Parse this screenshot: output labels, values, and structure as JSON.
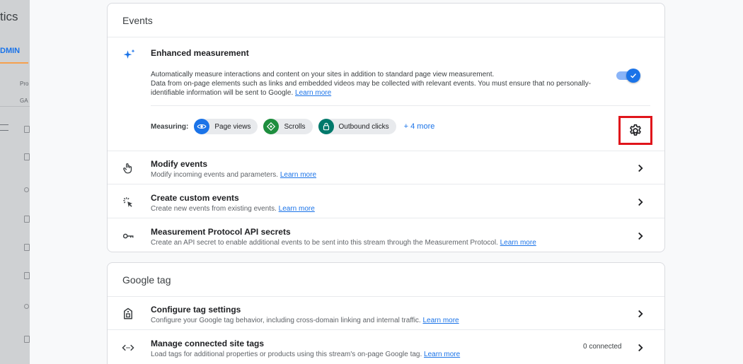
{
  "background": {
    "brand_partial": "tics",
    "admin_tab_partial": "DMIN",
    "property_partial": "Pro",
    "id_partial": "GA"
  },
  "events_card": {
    "title": "Events",
    "enhanced": {
      "title": "Enhanced measurement",
      "description_line1": "Automatically measure interactions and content on your sites in addition to standard page view measurement.",
      "description_line2": "Data from on-page elements such as links and embedded videos may be collected with relevant events. You must ensure that no personally-identifiable information will be sent to Google.",
      "learn_more": "Learn more",
      "toggle_on": true,
      "measuring_label": "Measuring:",
      "chips": [
        {
          "label": "Page views",
          "icon": "eye-icon",
          "color": "#1a73e8"
        },
        {
          "label": "Scrolls",
          "icon": "scroll-diamond-icon",
          "color": "#1e8e3e"
        },
        {
          "label": "Outbound clicks",
          "icon": "lock-icon",
          "color": "#00796b"
        }
      ],
      "more": "+ 4 more"
    },
    "rows": [
      {
        "title": "Modify events",
        "desc": "Modify incoming events and parameters.",
        "link": "Learn more",
        "icon": "touch-icon"
      },
      {
        "title": "Create custom events",
        "desc": "Create new events from existing events.",
        "link": "Learn more",
        "icon": "sparkle-click-icon"
      },
      {
        "title": "Measurement Protocol API secrets",
        "desc": "Create an API secret to enable additional events to be sent into this stream through the Measurement Protocol.",
        "link": "Learn more",
        "icon": "key-icon"
      }
    ]
  },
  "gtag_card": {
    "title": "Google tag",
    "rows": [
      {
        "title": "Configure tag settings",
        "desc": "Configure your Google tag behavior, including cross-domain linking and internal traffic.",
        "link": "Learn more",
        "icon": "tag-icon"
      },
      {
        "title": "Manage connected site tags",
        "desc": "Load tags for additional properties or products using this stream's on-page Google tag.",
        "link": "Learn more",
        "icon": "code-icon",
        "status": "0 connected"
      }
    ]
  },
  "colors": {
    "accent": "#1a73e8",
    "highlight_box": "#e0151b"
  }
}
